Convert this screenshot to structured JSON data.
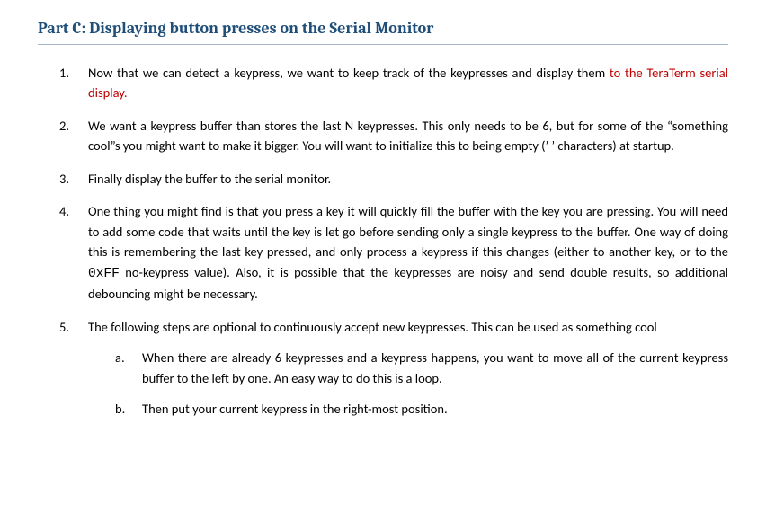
{
  "heading": "Part C: Displaying button presses on the Serial Monitor",
  "items": {
    "i1_a": "Now that we can detect a keypress, we want to keep track of the keypresses and display them ",
    "i1_b": "to the TeraTerm serial display.",
    "i2": "We want a keypress buffer than stores the last N keypresses. This only needs to be 6, but for some of the “something cool”s you might want to make it bigger. You will want to initialize this to being empty (’ ’ characters) at startup.",
    "i3": "Finally display the buffer to the serial monitor.",
    "i4_a": "One thing you might find is that you press a key it will quickly fill the buffer with the key you are pressing. You will need to add some code that waits until the key is let go before sending only a single keypress to the buffer. One way of doing this is remembering the last key pressed, and only process a keypress if this changes (either to another key, or to the ",
    "i4_code": "0xFF",
    "i4_b": " no-keypress value). Also, it is possible that the keypresses are noisy and send double results, so additional debouncing might be necessary.",
    "i5": "The following steps are optional to continuously accept new keypresses. This can be used as something cool",
    "i5a": "When there are already 6 keypresses and a keypress happens, you want to move all of the current keypress buffer to the left by one. An easy way to do this is a loop.",
    "i5b": "Then put your current keypress in the right-most position."
  }
}
